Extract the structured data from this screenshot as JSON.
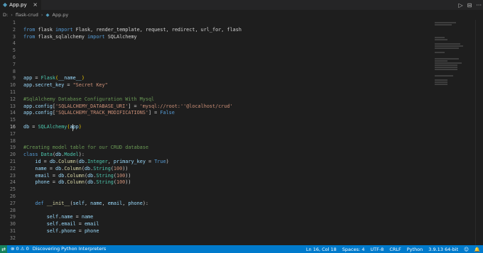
{
  "tab": {
    "file_name": "App.py",
    "close": "×"
  },
  "toolbar": {
    "run": "▷",
    "split": "⊟",
    "more": "···"
  },
  "breadcrumb": [
    "D:",
    "flask-crud",
    "App.py"
  ],
  "line_numbers": [
    "1",
    "2",
    "3",
    "4",
    "5",
    "6",
    "7",
    "8",
    "9",
    "10",
    "11",
    "12",
    "13",
    "14",
    "15",
    "16",
    "17",
    "18",
    "19",
    "20",
    "21",
    "22",
    "23",
    "24",
    "25",
    "26",
    "27",
    "28",
    "29",
    "30",
    "31",
    "32"
  ],
  "active_line": "16",
  "code": {
    "l2": [
      "from",
      " flask ",
      "import",
      " Flask, render_template, request, redirect, url_for, flash"
    ],
    "l3": [
      "from",
      " flask_sqlalchemy ",
      "import",
      " SQLAlchemy"
    ],
    "l9": [
      "app",
      " = ",
      "Flask",
      "(",
      "__name__",
      ")"
    ],
    "l10": [
      "app",
      ".",
      "secret_key",
      " = ",
      "\"Secret Key\""
    ],
    "l12": "#SqlAlchemy Database Configuration With Mysql",
    "l13": [
      "app",
      ".",
      "config",
      "[",
      "'SQLALCHEMY_DATABASE_URI'",
      "] = ",
      "'mysql://root:''@localhost/crud'"
    ],
    "l14": [
      "app",
      ".",
      "config",
      "[",
      "'SQLALCHEMY_TRACK_MODIFICATIONS'",
      "] = ",
      "False"
    ],
    "l16": [
      "db",
      " = ",
      "SQLAlchemy",
      "(",
      "app",
      ")"
    ],
    "l19": "#Creating model table for our CRUD database",
    "l20": [
      "class",
      " ",
      "Data",
      "(",
      "db",
      ".",
      "Model",
      "):"
    ],
    "l21": [
      "id",
      " = ",
      "db",
      ".",
      "Column",
      "(",
      "db",
      ".",
      "Integer",
      ", ",
      "primary_key",
      " = ",
      "True",
      ")"
    ],
    "l22": [
      "name",
      " = ",
      "db",
      ".",
      "Column",
      "(",
      "db",
      ".",
      "String",
      "(",
      "100",
      "))"
    ],
    "l23": [
      "email",
      " = ",
      "db",
      ".",
      "Column",
      "(",
      "db",
      ".",
      "String",
      "(",
      "100",
      "))"
    ],
    "l24": [
      "phone",
      " = ",
      "db",
      ".",
      "Column",
      "(",
      "db",
      ".",
      "String",
      "(",
      "100",
      "))"
    ],
    "l27": [
      "def",
      " ",
      "__init__",
      "(",
      "self",
      ", ",
      "name",
      ", ",
      "email",
      ", ",
      "phone",
      "):"
    ],
    "l29": [
      "self",
      ".",
      "name",
      " = ",
      "name"
    ],
    "l30": [
      "self",
      ".",
      "email",
      " = ",
      "email"
    ],
    "l31": [
      "self",
      ".",
      "phone",
      " = ",
      "phone"
    ]
  },
  "statusbar": {
    "left_icon": "⇄",
    "problems": "⊗ 0  ⚠ 0",
    "message": "Discovering Python Interpreters",
    "position": "Ln 16, Col 18",
    "spaces": "Spaces: 4",
    "encoding": "UTF-8",
    "eol": "CRLF",
    "language": "Python",
    "interpreter": "3.9.13 64-bit",
    "feedback": "☺",
    "bell": "🔔"
  },
  "colors": {
    "accent": "#007acc",
    "background": "#1e1e1e",
    "keyword": "#569cd6",
    "string": "#ce9178",
    "comment": "#6a9955"
  }
}
